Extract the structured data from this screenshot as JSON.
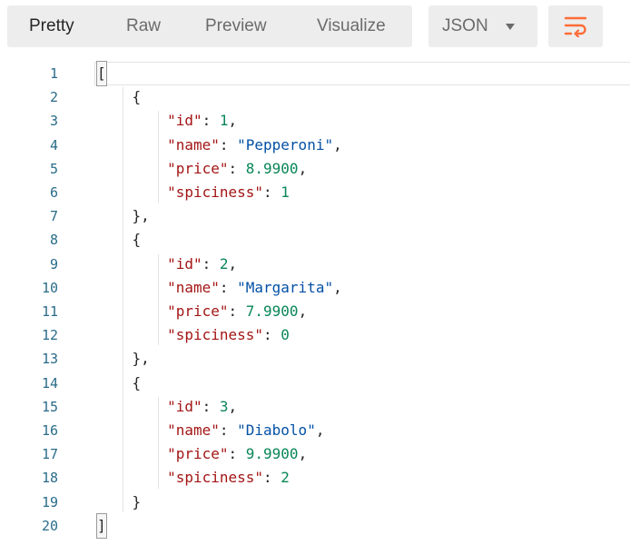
{
  "toolbar": {
    "tabs": [
      {
        "label": "Pretty",
        "active": true
      },
      {
        "label": "Raw",
        "active": false
      },
      {
        "label": "Preview",
        "active": false
      },
      {
        "label": "Visualize",
        "active": false
      }
    ],
    "format": {
      "selected": "JSON",
      "icon": "chevron-down-icon"
    },
    "wrap": {
      "icon": "wrap-lines-icon",
      "color": "#ff6c37"
    }
  },
  "editor": {
    "colors": {
      "line_number": "#2a6c89",
      "key": "#a31515",
      "string": "#0451a5",
      "number": "#098658"
    },
    "lines": [
      {
        "n": "1",
        "tokens": [
          {
            "t": "[",
            "k": "bracket"
          }
        ]
      },
      {
        "n": "2",
        "tokens": [
          {
            "t": "    {",
            "k": "punc"
          }
        ]
      },
      {
        "n": "3",
        "tokens": [
          {
            "t": "        ",
            "k": "punc"
          },
          {
            "t": "\"id\"",
            "k": "key"
          },
          {
            "t": ": ",
            "k": "punc"
          },
          {
            "t": "1",
            "k": "num"
          },
          {
            "t": ",",
            "k": "punc"
          }
        ]
      },
      {
        "n": "4",
        "tokens": [
          {
            "t": "        ",
            "k": "punc"
          },
          {
            "t": "\"name\"",
            "k": "key"
          },
          {
            "t": ": ",
            "k": "punc"
          },
          {
            "t": "\"Pepperoni\"",
            "k": "str"
          },
          {
            "t": ",",
            "k": "punc"
          }
        ]
      },
      {
        "n": "5",
        "tokens": [
          {
            "t": "        ",
            "k": "punc"
          },
          {
            "t": "\"price\"",
            "k": "key"
          },
          {
            "t": ": ",
            "k": "punc"
          },
          {
            "t": "8.9900",
            "k": "num"
          },
          {
            "t": ",",
            "k": "punc"
          }
        ]
      },
      {
        "n": "6",
        "tokens": [
          {
            "t": "        ",
            "k": "punc"
          },
          {
            "t": "\"spiciness\"",
            "k": "key"
          },
          {
            "t": ": ",
            "k": "punc"
          },
          {
            "t": "1",
            "k": "num"
          }
        ]
      },
      {
        "n": "7",
        "tokens": [
          {
            "t": "    },",
            "k": "punc"
          }
        ]
      },
      {
        "n": "8",
        "tokens": [
          {
            "t": "    {",
            "k": "punc"
          }
        ]
      },
      {
        "n": "9",
        "tokens": [
          {
            "t": "        ",
            "k": "punc"
          },
          {
            "t": "\"id\"",
            "k": "key"
          },
          {
            "t": ": ",
            "k": "punc"
          },
          {
            "t": "2",
            "k": "num"
          },
          {
            "t": ",",
            "k": "punc"
          }
        ]
      },
      {
        "n": "10",
        "tokens": [
          {
            "t": "        ",
            "k": "punc"
          },
          {
            "t": "\"name\"",
            "k": "key"
          },
          {
            "t": ": ",
            "k": "punc"
          },
          {
            "t": "\"Margarita\"",
            "k": "str"
          },
          {
            "t": ",",
            "k": "punc"
          }
        ]
      },
      {
        "n": "11",
        "tokens": [
          {
            "t": "        ",
            "k": "punc"
          },
          {
            "t": "\"price\"",
            "k": "key"
          },
          {
            "t": ": ",
            "k": "punc"
          },
          {
            "t": "7.9900",
            "k": "num"
          },
          {
            "t": ",",
            "k": "punc"
          }
        ]
      },
      {
        "n": "12",
        "tokens": [
          {
            "t": "        ",
            "k": "punc"
          },
          {
            "t": "\"spiciness\"",
            "k": "key"
          },
          {
            "t": ": ",
            "k": "punc"
          },
          {
            "t": "0",
            "k": "num"
          }
        ]
      },
      {
        "n": "13",
        "tokens": [
          {
            "t": "    },",
            "k": "punc"
          }
        ]
      },
      {
        "n": "14",
        "tokens": [
          {
            "t": "    {",
            "k": "punc"
          }
        ]
      },
      {
        "n": "15",
        "tokens": [
          {
            "t": "        ",
            "k": "punc"
          },
          {
            "t": "\"id\"",
            "k": "key"
          },
          {
            "t": ": ",
            "k": "punc"
          },
          {
            "t": "3",
            "k": "num"
          },
          {
            "t": ",",
            "k": "punc"
          }
        ]
      },
      {
        "n": "16",
        "tokens": [
          {
            "t": "        ",
            "k": "punc"
          },
          {
            "t": "\"name\"",
            "k": "key"
          },
          {
            "t": ": ",
            "k": "punc"
          },
          {
            "t": "\"Diabolo\"",
            "k": "str"
          },
          {
            "t": ",",
            "k": "punc"
          }
        ]
      },
      {
        "n": "17",
        "tokens": [
          {
            "t": "        ",
            "k": "punc"
          },
          {
            "t": "\"price\"",
            "k": "key"
          },
          {
            "t": ": ",
            "k": "punc"
          },
          {
            "t": "9.9900",
            "k": "num"
          },
          {
            "t": ",",
            "k": "punc"
          }
        ]
      },
      {
        "n": "18",
        "tokens": [
          {
            "t": "        ",
            "k": "punc"
          },
          {
            "t": "\"spiciness\"",
            "k": "key"
          },
          {
            "t": ": ",
            "k": "punc"
          },
          {
            "t": "2",
            "k": "num"
          }
        ]
      },
      {
        "n": "19",
        "tokens": [
          {
            "t": "    }",
            "k": "punc"
          }
        ]
      },
      {
        "n": "20",
        "tokens": [
          {
            "t": "]",
            "k": "bracket"
          }
        ]
      }
    ]
  }
}
